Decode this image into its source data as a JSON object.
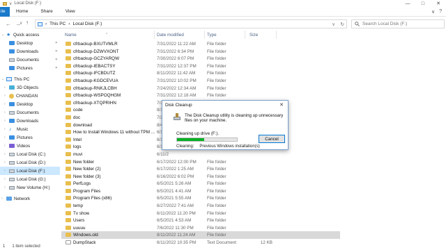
{
  "window": {
    "title": "Local Disk (F:)",
    "qat_arrow": "∨",
    "buttons": {
      "minimize": "—",
      "maximize": "□",
      "close": "✕"
    }
  },
  "ribbon": {
    "file_tab": "ile",
    "tabs": [
      "Home",
      "Share",
      "View"
    ],
    "collapse": "∨",
    "help": "?"
  },
  "addressbar": {
    "back": "←",
    "forward": "→",
    "dropdown": "∨",
    "up": "↑",
    "crumb1": "This PC",
    "crumb_sep": "›",
    "crumb2": "Local Disk (F:)",
    "chevron": "∨",
    "refresh": "↻"
  },
  "search": {
    "placeholder": "Search Local Disk (F:)",
    "icon": "search-icon"
  },
  "nav": {
    "quick_access": "Quick access",
    "items_pinned": [
      {
        "label": "Desktop",
        "icon": "desktop-icon"
      },
      {
        "label": "Downloads",
        "icon": "downloads-icon"
      },
      {
        "label": "Documents",
        "icon": "documents-icon"
      },
      {
        "label": "Pictures",
        "icon": "pictures-icon"
      }
    ],
    "pin_glyph": "✶",
    "this_pc": "This PC",
    "pc_items": [
      "3D Objects",
      "CHANDAN",
      "Desktop",
      "Documents",
      "Downloads",
      "Music",
      "Pictures",
      "Videos",
      "Local Disk (C:)",
      "Local Disk (D:)",
      "Local Disk (F:)",
      "Local Disk (G:)",
      "New Volume (H:)"
    ],
    "network": "Network"
  },
  "columns": {
    "name": "Name",
    "date": "Date modified",
    "type": "Type",
    "size": "Size",
    "sort_caret": "^"
  },
  "files": [
    {
      "name": "cfrbackup-BXUTVMLR",
      "date": "7/31/2022 11:22 AM",
      "type": "File folder",
      "size": ""
    },
    {
      "name": "cfrbackup-DZWVXONT",
      "date": "7/31/2022 6:34 PM",
      "type": "File folder",
      "size": ""
    },
    {
      "name": "cfrbackup-GCZYARQW",
      "date": "7/30/2022 6:07 PM",
      "type": "File folder",
      "size": ""
    },
    {
      "name": "cfrbackup-IEBACTSY",
      "date": "7/31/2022 12:37 PM",
      "type": "File folder",
      "size": ""
    },
    {
      "name": "cfrbackup-IFCBDUTZ",
      "date": "8/11/2022 11:42 AM",
      "type": "File folder",
      "size": ""
    },
    {
      "name": "cfrbackup-KGDCEVUA",
      "date": "7/31/2022 10:02 PM",
      "type": "File folder",
      "size": ""
    },
    {
      "name": "cfrbackup-RNKJLCBH",
      "date": "7/24/2022 12:34 AM",
      "type": "File folder",
      "size": ""
    },
    {
      "name": "cfrbackup-WSPOQHGM",
      "date": "7/31/2022 12:18 AM",
      "type": "File folder",
      "size": ""
    },
    {
      "name": "cfrbackup-XTQPRIHN",
      "date": "7/31/2022 11:14 AM",
      "type": "File folder",
      "size": ""
    },
    {
      "name": "code",
      "date": "8/10/2",
      "type": "",
      "size": ""
    },
    {
      "name": "doc",
      "date": "7/29/2",
      "type": "",
      "size": ""
    },
    {
      "name": "download",
      "date": "8/4/2",
      "type": "",
      "size": ""
    },
    {
      "name": "How to Install Windows 11 without TPM ...",
      "date": "6/11/2",
      "type": "",
      "size": ""
    },
    {
      "name": "Intel",
      "date": "6/11/2",
      "type": "",
      "size": ""
    },
    {
      "name": "logs",
      "date": "6/11/2",
      "type": "",
      "size": ""
    },
    {
      "name": "muvi",
      "date": "6/11/2",
      "type": "",
      "size": ""
    },
    {
      "name": "New folder",
      "date": "6/17/2022 12:00 PM",
      "type": "File folder",
      "size": ""
    },
    {
      "name": "New folder (2)",
      "date": "6/17/2022 1:25 AM",
      "type": "File folder",
      "size": ""
    },
    {
      "name": "New folder (3)",
      "date": "6/16/2022 6:02 PM",
      "type": "File folder",
      "size": ""
    },
    {
      "name": "PerfLogs",
      "date": "6/5/2021 5:26 AM",
      "type": "File folder",
      "size": ""
    },
    {
      "name": "Program Files",
      "date": "6/5/2021 4:41 AM",
      "type": "File folder",
      "size": ""
    },
    {
      "name": "Program Files (x86)",
      "date": "6/5/2021 5:55 AM",
      "type": "File folder",
      "size": ""
    },
    {
      "name": "temp",
      "date": "6/27/2022 7:41 AM",
      "type": "File folder",
      "size": ""
    },
    {
      "name": "Tv show",
      "date": "6/11/2022 11:20 PM",
      "type": "File folder",
      "size": ""
    },
    {
      "name": "Users",
      "date": "6/5/2021 4:53 AM",
      "type": "File folder",
      "size": ""
    },
    {
      "name": "uuuuu",
      "date": "7/6/2022 11:30 PM",
      "type": "File folder",
      "size": ""
    },
    {
      "name": "Windows.old",
      "date": "8/11/2022 11:24 AM",
      "type": "File folder",
      "size": "",
      "selected": true
    },
    {
      "name": "DumpStack",
      "date": "6/11/2022 10:35 PM",
      "type": "Text Document",
      "size": "12 KB",
      "doc": true
    }
  ],
  "status": {
    "count": "1",
    "selected": "1 item selected"
  },
  "dialog": {
    "title": "Disk Cleanup",
    "close": "✕",
    "message": "The Disk Cleanup utility is cleaning up unnecessary files on your machine.",
    "cleaning_drive": "Cleaning up drive (F:).",
    "progress": 0.45,
    "cancel": "Cancel",
    "cleaning_label": "Cleaning:",
    "cleaning_item": "Previous Windows installation(s)"
  }
}
